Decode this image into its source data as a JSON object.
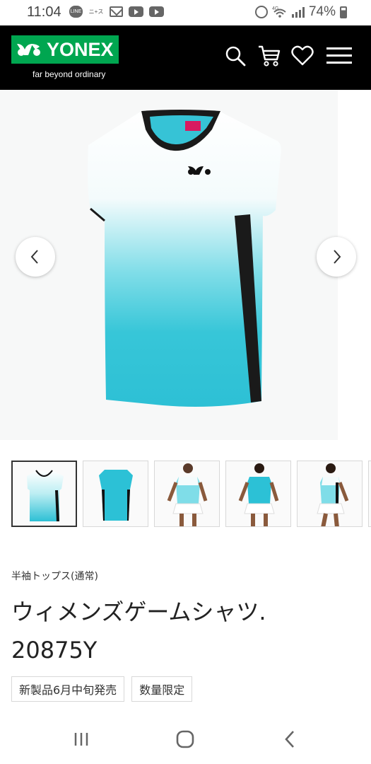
{
  "status_bar": {
    "time": "11:04",
    "left_icons": [
      "line-icon",
      "news-icon",
      "mail-icon",
      "youtube-icon",
      "youtube-icon"
    ],
    "right_icons": [
      "alarm-icon",
      "wifi-icon",
      "signal-icon",
      "battery-icon"
    ],
    "network_label": "4G",
    "battery_percent": "74%"
  },
  "header": {
    "brand": "YONEX",
    "tagline": "far beyond ordinary",
    "icons": [
      "search-icon",
      "cart-icon",
      "heart-icon",
      "menu-icon"
    ],
    "background": "#000000",
    "brand_color": "#00a650"
  },
  "gallery": {
    "prev_icon": "chevron-left-icon",
    "next_icon": "chevron-right-icon",
    "active_index": 0,
    "thumbnails": [
      "shirt-front",
      "shirt-back",
      "model-front",
      "model-back",
      "model-side"
    ],
    "accent": "#2cc3d6"
  },
  "product": {
    "category": "半袖トップス(通常)",
    "title": "ウィメンズゲームシャツ.",
    "code": "20875Y",
    "tags": [
      "新製品6月中旬発売",
      "数量限定"
    ]
  },
  "nav_bar": {
    "icons": [
      "recents-icon",
      "home-icon",
      "back-icon"
    ]
  }
}
